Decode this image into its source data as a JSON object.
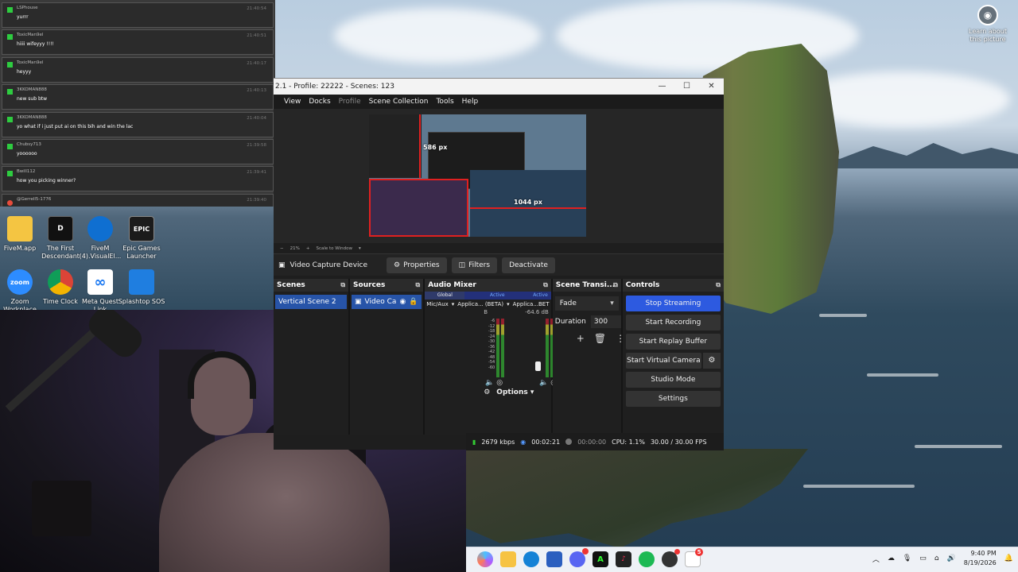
{
  "learn": {
    "label_line1": "Learn about",
    "label_line2": "this picture"
  },
  "chat": {
    "messages": [
      {
        "user": "LSPhouse",
        "time": "21:40:54",
        "text": "yurrr"
      },
      {
        "user": "ToxicMan9el",
        "time": "21:40:51",
        "text": "hiiii wifeyyy !!!!"
      },
      {
        "user": "ToxicMan9el",
        "time": "21:40:17",
        "text": "heyyy"
      },
      {
        "user": "3KKOMAN888",
        "time": "21:40:13",
        "text": "new sub btw"
      },
      {
        "user": "3KKOMAN888",
        "time": "21:40:04",
        "text": "yo what if i just put ai on this bih and win the lac"
      },
      {
        "user": "Chubsy713",
        "time": "21:39:58",
        "text": "yoooooo"
      },
      {
        "user": "Bwill112",
        "time": "21:39:41",
        "text": "how you picking winner?"
      },
      {
        "user": "@Gerrell5-1776",
        "time": "21:39:40",
        "text": ""
      }
    ]
  },
  "desktop_icons": [
    {
      "label": "FiveM.app",
      "glyph": "",
      "color": "#f4c542"
    },
    {
      "label": "The First Descendant",
      "glyph": "D",
      "color": "#111111"
    },
    {
      "label": "FiveM (4).VisualEl...",
      "glyph": "",
      "color": "#0f6fd1"
    },
    {
      "label": "Epic Games Launcher",
      "glyph": "EPIC",
      "color": "#1b1b1b"
    },
    {
      "label": "Zoom Workplace",
      "glyph": "zoom",
      "color": "#2d8cff"
    },
    {
      "label": "Time Clock",
      "glyph": "",
      "color": "#e8e8e8"
    },
    {
      "label": "Meta Quest Link",
      "glyph": "∞",
      "color": "#ffffff"
    },
    {
      "label": "Splashtop SOS",
      "glyph": "",
      "color": "#1f7ee0"
    }
  ],
  "obs": {
    "title": "2.1 - Profile: 22222 - Scenes: 123",
    "menu": [
      "View",
      "Docks",
      "Profile",
      "Scene Collection",
      "Tools",
      "Help"
    ],
    "preview": {
      "label_top": "586 px",
      "label_right": "1044 px",
      "zoom": "21%",
      "scale_mode": "Scale to Window"
    },
    "source_bar": {
      "source_name": "Video Capture Device",
      "properties": "Properties",
      "filters": "Filters",
      "deactivate": "Deactivate"
    },
    "scenes": {
      "title": "Scenes",
      "items": [
        "Vertical Scene 2"
      ]
    },
    "sources": {
      "title": "Sources",
      "items": [
        "Video Ca"
      ]
    },
    "audio_mixer": {
      "title": "Audio Mixer",
      "tab_global": "Global",
      "tab_active_1": "Active",
      "tab_active_2": "Active",
      "ch1": "Mic/Aux",
      "ch2": "Applica... (BETA)",
      "ch3": "Applica...BET",
      "db_left": "B",
      "db_right": "-64.6 dB",
      "scale": [
        "-6",
        "-12",
        "-18",
        "-24",
        "-30",
        "-36",
        "-42",
        "-48",
        "-54",
        "-60"
      ],
      "options": "Options"
    },
    "transitions": {
      "title": "Scene Transi...",
      "selected": "Fade",
      "duration_label": "Duration",
      "duration_value": "300"
    },
    "controls": {
      "title": "Controls",
      "stop_streaming": "Stop Streaming",
      "start_recording": "Start Recording",
      "start_replay": "Start Replay Buffer",
      "start_virtual_cam": "Start Virtual Camera",
      "studio_mode": "Studio Mode",
      "settings": "Settings"
    },
    "status": {
      "bitrate": "2679 kbps",
      "stream_time": "00:02:21",
      "record_time": "00:00:00",
      "cpu": "CPU: 1.1%",
      "fps": "30.00 / 30.00 FPS"
    }
  },
  "taskbar": {
    "clock_time": "9:40 PM",
    "clock_date": "8/19/2026",
    "notification_count": "5",
    "apps": [
      "copilot",
      "file-explorer",
      "edge",
      "store",
      "discord",
      "terminal",
      "capcut",
      "spotify",
      "obs",
      "notepad"
    ]
  }
}
